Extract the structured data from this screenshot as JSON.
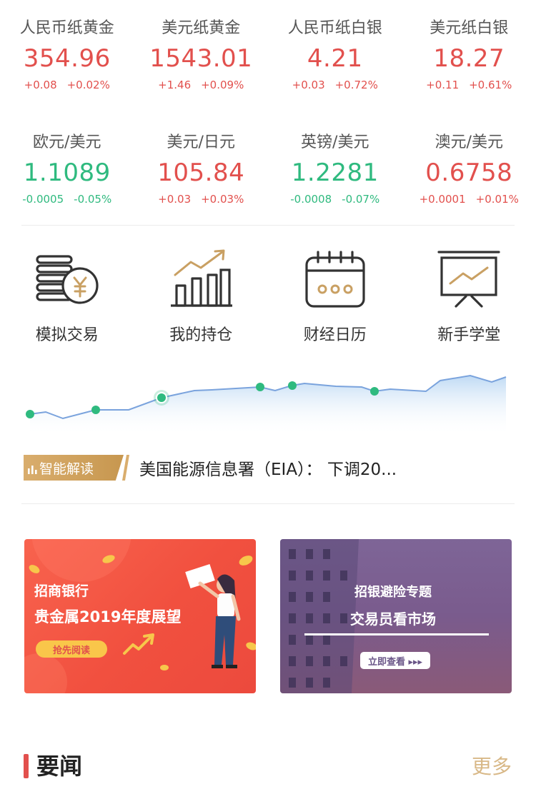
{
  "quotes": [
    {
      "name": "人民币纸黄金",
      "price": "354.96",
      "change": "+0.08",
      "percent": "+0.02%",
      "trend": "up"
    },
    {
      "name": "美元纸黄金",
      "price": "1543.01",
      "change": "+1.46",
      "percent": "+0.09%",
      "trend": "up"
    },
    {
      "name": "人民币纸白银",
      "price": "4.21",
      "change": "+0.03",
      "percent": "+0.72%",
      "trend": "up"
    },
    {
      "name": "美元纸白银",
      "price": "18.27",
      "change": "+0.11",
      "percent": "+0.61%",
      "trend": "up"
    },
    {
      "name": "欧元/美元",
      "price": "1.1089",
      "change": "-0.0005",
      "percent": "-0.05%",
      "trend": "down"
    },
    {
      "name": "美元/日元",
      "price": "105.84",
      "change": "+0.03",
      "percent": "+0.03%",
      "trend": "up"
    },
    {
      "name": "英镑/美元",
      "price": "1.2281",
      "change": "-0.0008",
      "percent": "-0.07%",
      "trend": "down"
    },
    {
      "name": "澳元/美元",
      "price": "0.6758",
      "change": "+0.0001",
      "percent": "+0.01%",
      "trend": "up"
    }
  ],
  "functions": [
    {
      "label": "模拟交易",
      "icon": "coins-yuan-icon"
    },
    {
      "label": "我的持仓",
      "icon": "bar-chart-trend-icon"
    },
    {
      "label": "财经日历",
      "icon": "calendar-icon"
    },
    {
      "label": "新手学堂",
      "icon": "presentation-board-icon"
    }
  ],
  "smart_reading": {
    "badge": "智能解读",
    "headline": "美国能源信息署（EIA）： 下调20..."
  },
  "banners": {
    "left": {
      "title1": "招商银行",
      "title2": "贵金属2019年度展望",
      "button": "抢先阅读"
    },
    "right": {
      "title1": "招银避险专题",
      "title2": "交易员看市场",
      "button": "立即查看 ▸▸▸"
    }
  },
  "news": {
    "title": "要闻",
    "more": "更多"
  },
  "colors": {
    "up": "#e2504d",
    "down": "#2fba7f",
    "accent_gold": "#d8b887",
    "chart_line": "#7aa3dd",
    "chart_dot": "#2fba7f"
  }
}
